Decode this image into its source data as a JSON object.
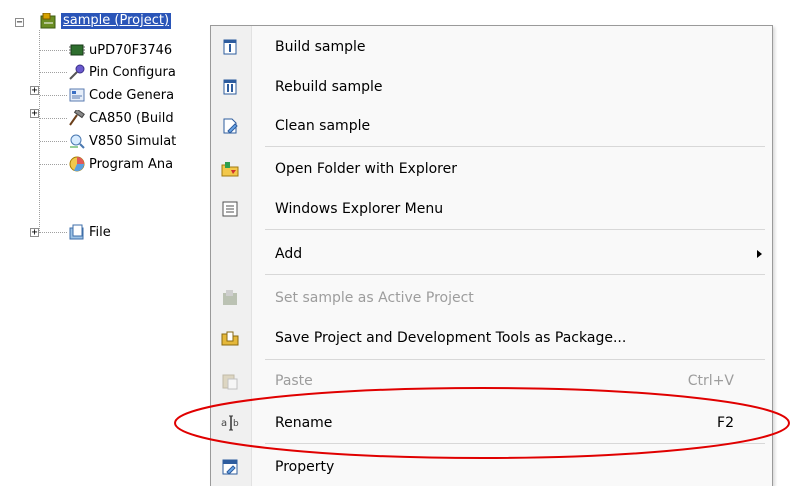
{
  "tree": {
    "root": {
      "label": "sample (Project)",
      "expander": "−",
      "icon": "project-icon"
    },
    "children": [
      {
        "label": "uPD70F3746",
        "icon": "microcontroller-icon",
        "expander": ""
      },
      {
        "label": "Pin Configura",
        "icon": "pin-configurator-icon",
        "expander": "+"
      },
      {
        "label": "Code Genera",
        "icon": "code-generator-icon",
        "expander": "+"
      },
      {
        "label": "CA850 (Build",
        "icon": "build-tool-hammer-icon",
        "expander": ""
      },
      {
        "label": "V850 Simulat",
        "icon": "simulator-debugger-icon",
        "expander": ""
      },
      {
        "label": "Program Ana",
        "icon": "program-analyzer-icon",
        "expander": ""
      },
      {
        "label": "File",
        "icon": "file-folder-icon",
        "expander": "+"
      }
    ]
  },
  "menu": {
    "items": [
      {
        "label": "Build sample",
        "shortcut": "",
        "icon": "build-icon",
        "enabled": true
      },
      {
        "label": "Rebuild sample",
        "shortcut": "",
        "icon": "rebuild-icon",
        "enabled": true
      },
      {
        "label": "Clean sample",
        "shortcut": "",
        "icon": "clean-icon",
        "enabled": true
      },
      {
        "label": "Open Folder with Explorer",
        "shortcut": "",
        "icon": "open-folder-icon",
        "enabled": true
      },
      {
        "label": "Windows Explorer Menu",
        "shortcut": "",
        "icon": "explorer-menu-icon",
        "enabled": true
      },
      {
        "label": "Add",
        "shortcut": "",
        "icon": "",
        "enabled": true,
        "submenu": true
      },
      {
        "label": "Set sample as Active Project",
        "shortcut": "",
        "icon": "active-project-icon",
        "enabled": false
      },
      {
        "label": "Save Project and Development Tools as Package...",
        "shortcut": "",
        "icon": "package-icon",
        "enabled": true
      },
      {
        "label": "Paste",
        "shortcut": "Ctrl+V",
        "icon": "paste-icon",
        "enabled": false
      },
      {
        "label": "Rename",
        "shortcut": "F2",
        "icon": "rename-icon",
        "enabled": true,
        "highlighted_by_annotation": true
      },
      {
        "label": "Property",
        "shortcut": "",
        "icon": "property-icon",
        "enabled": true
      }
    ]
  },
  "colors": {
    "selection": "#2a55b8",
    "annotation": "#e00000",
    "disabled_text": "#9d9d9d",
    "menu_bg": "#f9f9f9"
  }
}
